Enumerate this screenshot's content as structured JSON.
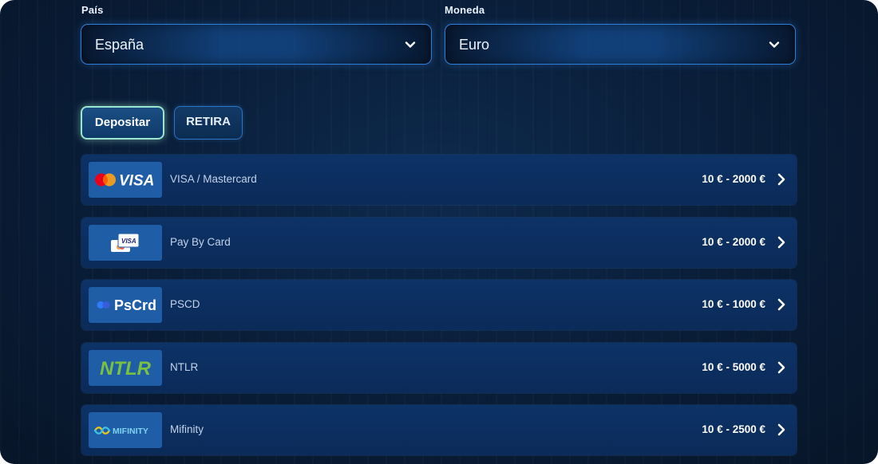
{
  "country": {
    "label": "País",
    "value": "España"
  },
  "currency": {
    "label": "Moneda",
    "value": "Euro"
  },
  "tabs": {
    "deposit": "Depositar",
    "withdraw": "RETIRA"
  },
  "methods": [
    {
      "name": "VISA / Mastercard",
      "limit": "10 € - 2000 €",
      "logo_text": "VISA"
    },
    {
      "name": "Pay By Card",
      "limit": "10 € - 2000 €",
      "logo_text": "VISA"
    },
    {
      "name": "PSCD",
      "limit": "10 € - 1000 €",
      "logo_text": "PsCrd"
    },
    {
      "name": "NTLR",
      "limit": "10 € - 5000 €",
      "logo_text": "NTLR"
    },
    {
      "name": "Mifinity",
      "limit": "10 € - 2500 €",
      "logo_text": "MIFINITY"
    }
  ],
  "colors": {
    "accent": "#2f7fd8",
    "active_tab_border": "#9be6cf",
    "row_bg": "#0d3266",
    "ntlr_green": "#7ac143"
  }
}
